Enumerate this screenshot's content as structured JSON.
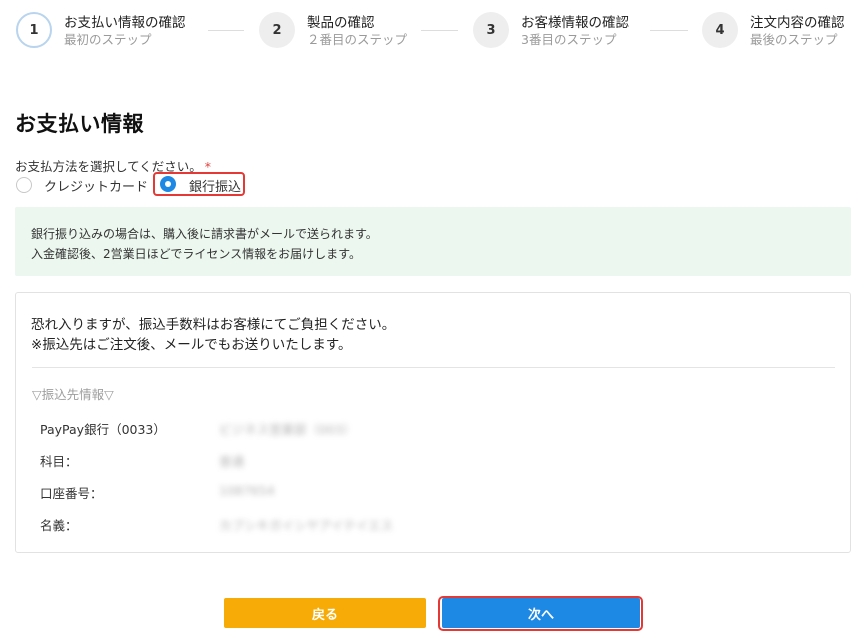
{
  "stepper": {
    "steps": [
      {
        "number": "1",
        "title": "お支払い情報の確認",
        "subtitle": "最初のステップ",
        "active": true
      },
      {
        "number": "2",
        "title": "製品の確認",
        "subtitle": "２番目のステップ",
        "active": false
      },
      {
        "number": "3",
        "title": "お客様情報の確認",
        "subtitle": "3番目のステップ",
        "active": false
      },
      {
        "number": "4",
        "title": "注文内容の確認",
        "subtitle": "最後のステップ",
        "active": false
      }
    ]
  },
  "page": {
    "title": "お支払い情報"
  },
  "payment": {
    "method_label": "お支払方法を選択してください。",
    "required_mark": "*",
    "options": [
      {
        "label": "クレジットカード",
        "selected": false
      },
      {
        "label": "銀行振込",
        "selected": true
      }
    ]
  },
  "info": {
    "line1": "銀行振り込みの場合は、購入後に請求書がメールで送られます。",
    "line2": "入金確認後、2営業日ほどでライセンス情報をお届けします。"
  },
  "transfer": {
    "line1": "恐れ入りますが、振込手数料はお客様にてご負担ください。",
    "line2": "※振込先はご注文後、メールでもお送りいたします。",
    "heading": "▽振込先情報▽",
    "rows": [
      {
        "label": "PayPay銀行（0033）",
        "value": "ビジネス営業部（003）"
      },
      {
        "label": "科目：",
        "value": "普通"
      },
      {
        "label": "口座番号：",
        "value": "1087654"
      },
      {
        "label": "名義：",
        "value": "カブシキガイシヤアイテイエス"
      }
    ]
  },
  "buttons": {
    "back": "戻る",
    "next": "次へ"
  },
  "colors": {
    "primary": "#1e88e5",
    "warning": "#f7ab06",
    "highlight": "#e53935",
    "info_bg": "#ecf7ef"
  }
}
